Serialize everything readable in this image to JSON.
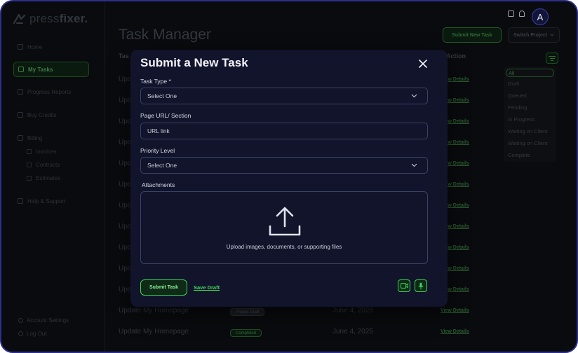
{
  "app": {
    "brand_light": "press",
    "brand_bold": "fixer.",
    "avatar_initial": "A"
  },
  "sidebar": {
    "items": [
      {
        "label": "Home",
        "icon": "home-icon"
      },
      {
        "label": "My Tasks",
        "icon": "tasks-icon",
        "active": true
      },
      {
        "label": "Progress Reports",
        "icon": "reports-icon"
      },
      {
        "label": "Buy Credits",
        "icon": "credits-icon"
      },
      {
        "label": "Billing",
        "icon": "billing-icon"
      }
    ],
    "billing_sub": [
      {
        "label": "Invoices",
        "icon": "invoice-icon"
      },
      {
        "label": "Contracts",
        "icon": "contract-icon"
      },
      {
        "label": "Estimates",
        "icon": "estimate-icon"
      }
    ],
    "help": {
      "label": "Help & Support",
      "icon": "help-icon"
    },
    "footer": [
      {
        "label": "Account Settings",
        "icon": "settings-icon"
      },
      {
        "label": "Log Out",
        "icon": "logout-icon"
      }
    ]
  },
  "header": {
    "title": "Task Manager",
    "new_task_button": "Submit New Task",
    "switch_project": "Switch Project"
  },
  "table": {
    "col_task": "Tas",
    "col_action": "Action",
    "rows": [
      {
        "title": "Upd",
        "link": "View Details"
      },
      {
        "title": "Upd",
        "link": "View Details"
      },
      {
        "title": "Upd",
        "link": "View Details"
      },
      {
        "title": "Upd",
        "link": "View Details"
      },
      {
        "title": "Upd",
        "link": "View Details"
      },
      {
        "title": "Upd",
        "link": "View Details"
      },
      {
        "title": "Upd",
        "link": "View Details"
      },
      {
        "title": "Upd",
        "link": "View Details"
      },
      {
        "title": "Upd",
        "link": "View Details"
      },
      {
        "title": "Upd",
        "link": "View Details"
      },
      {
        "title": "Upd",
        "link": "View Details"
      },
      {
        "title": "Update My Homepage",
        "badge": "Project Draft",
        "date": "June 4, 2025",
        "link": "View Details"
      },
      {
        "title": "Update My Homepage",
        "badge": "Completed",
        "date": "June 4, 2025",
        "link": "View Details"
      }
    ]
  },
  "filter": {
    "options": [
      "All",
      "Draft",
      "Queued",
      "Pending",
      "In Progress",
      "Waiting on Client",
      "Waiting on Client",
      "Complete"
    ],
    "selected": "All"
  },
  "modal": {
    "title": "Submit a New Task",
    "task_type_label": "Task Type *",
    "task_type_value": "Select One",
    "page_url_label": "Page URL/ Section",
    "page_url_placeholder": "URL link",
    "priority_label": "Priority Level",
    "priority_value": "Select One",
    "attachments_label": "Attachments",
    "dropzone_text": "Upload images, documents, or supporting files",
    "submit_label": "Submit Task",
    "save_draft_label": "Save Draft"
  },
  "colors": {
    "accent_green": "#3fd35a",
    "modal_bg": "#11142a",
    "page_bg": "#0a0b0e",
    "frame_border": "#2c2f8c"
  }
}
